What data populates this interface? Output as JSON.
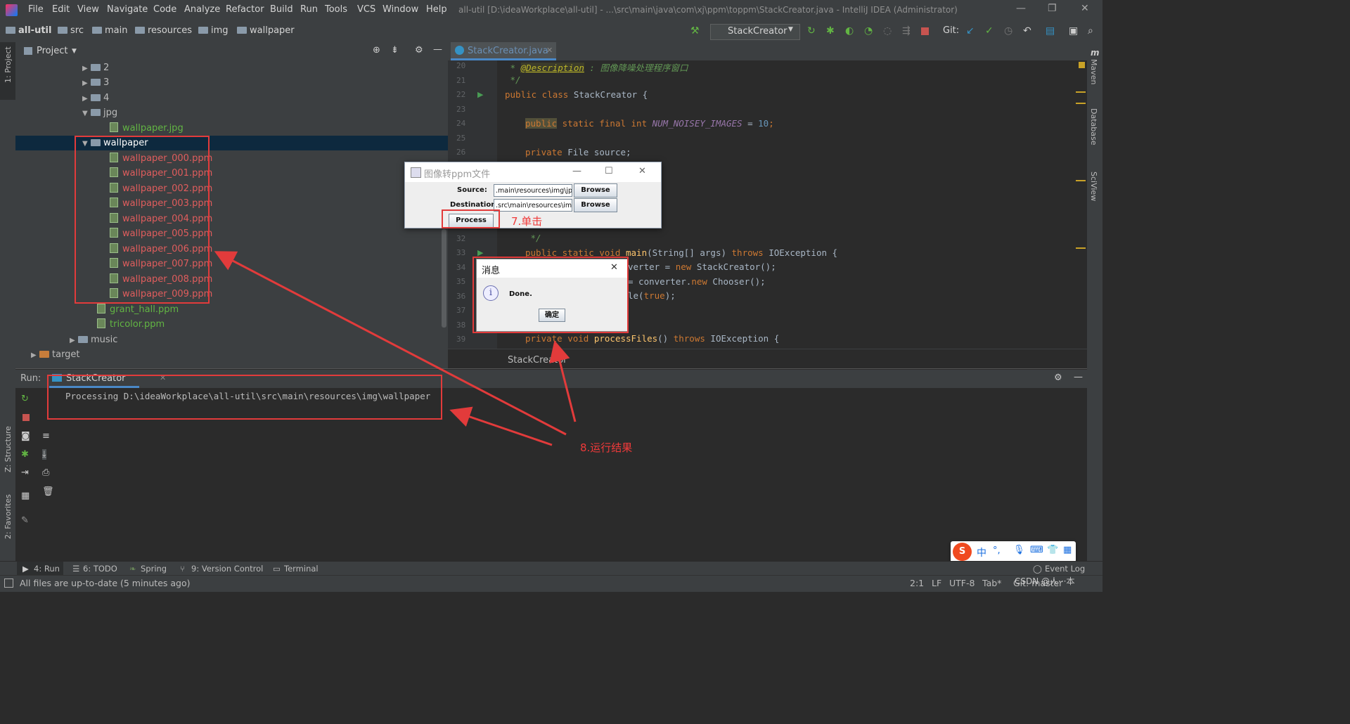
{
  "menubar": {
    "items": [
      "File",
      "Edit",
      "View",
      "Navigate",
      "Code",
      "Analyze",
      "Refactor",
      "Build",
      "Run",
      "Tools",
      "VCS",
      "Window",
      "Help"
    ],
    "window_title": "all-util [D:\\ideaWorkplace\\all-util] - ...\\src\\main\\java\\com\\xj\\ppm\\toppm\\StackCreator.java - IntelliJ IDEA (Administrator)"
  },
  "navbar": {
    "breadcrumbs": [
      "all-util",
      "src",
      "main",
      "resources",
      "img",
      "wallpaper"
    ],
    "run_config": "StackCreator",
    "git_label": "Git:"
  },
  "left_strip": {
    "project": "1: Project",
    "structure": "Z: Structure",
    "favorites": "2: Favorites"
  },
  "right_strip": {
    "maven": "Maven",
    "database": "Database",
    "sciview": "SciView"
  },
  "project_panel": {
    "title": "Project",
    "tree": [
      {
        "label": "2",
        "type": "folder",
        "expanded": false
      },
      {
        "label": "3",
        "type": "folder",
        "expanded": false
      },
      {
        "label": "4",
        "type": "folder",
        "expanded": false
      },
      {
        "label": "jpg",
        "type": "folder",
        "expanded": true
      },
      {
        "label": "wallpaper.jpg",
        "type": "file"
      },
      {
        "label": "wallpaper",
        "type": "folder",
        "expanded": true,
        "selected": true
      },
      {
        "label": "wallpaper_000.ppm",
        "type": "file"
      },
      {
        "label": "wallpaper_001.ppm",
        "type": "file"
      },
      {
        "label": "wallpaper_002.ppm",
        "type": "file"
      },
      {
        "label": "wallpaper_003.ppm",
        "type": "file"
      },
      {
        "label": "wallpaper_004.ppm",
        "type": "file"
      },
      {
        "label": "wallpaper_005.ppm",
        "type": "file"
      },
      {
        "label": "wallpaper_006.ppm",
        "type": "file"
      },
      {
        "label": "wallpaper_007.ppm",
        "type": "file"
      },
      {
        "label": "wallpaper_008.ppm",
        "type": "file"
      },
      {
        "label": "wallpaper_009.ppm",
        "type": "file"
      },
      {
        "label": "grant_hall.ppm",
        "type": "file"
      },
      {
        "label": "tricolor.ppm",
        "type": "file"
      },
      {
        "label": "music",
        "type": "folder",
        "expanded": false
      },
      {
        "label": "target",
        "type": "folder",
        "expanded": false
      }
    ]
  },
  "editor": {
    "tab_label": "StackCreator.java",
    "breadcrumb": "StackCreator",
    "line_numbers": [
      "20",
      "21",
      "22",
      "23",
      "24",
      "25",
      "26",
      "32",
      "33",
      "34",
      "35",
      "36",
      "37",
      "38",
      "39"
    ],
    "lines": {
      "l20_a": " * ",
      "l20_b": "@Description",
      "l20_c": " : 图像降噪处理程序窗口",
      "l21": " */",
      "l22_a": "public class ",
      "l22_b": "StackCreator {",
      "l24_a": "public",
      "l24_b": " static final int ",
      "l24_c": "NUM_NOISEY_IMAGES",
      "l24_d": " = ",
      "l24_e": "10",
      "l24_f": ";",
      "l26_a": "private ",
      "l26_b": "File source;",
      "l32": " */",
      "l33_a": "public static void ",
      "l33_b": "main",
      "l33_c": "(String[] args) ",
      "l33_d": "throws ",
      "l33_e": "IOException {",
      "l34_a": "verter = ",
      "l34_b": "new ",
      "l34_c": "StackCreator();",
      "l35_a": "= converter.",
      "l35_b": "new ",
      "l35_c": "Chooser();",
      "l36_a": "le(",
      "l36_b": "true",
      "l36_c": ");",
      "l39_a": "private void ",
      "l39_b": "processFiles",
      "l39_c": "() ",
      "l39_d": "throws ",
      "l39_e": "IOException {"
    }
  },
  "swing_dialog": {
    "title": "图像转ppm文件",
    "source_label": "Source:",
    "source_value": ".main\\resources\\img\\jpg",
    "destination_label": "Destination:",
    "destination_value": ".src\\main\\resources\\img",
    "browse_label": "Browse",
    "process_label": "Process"
  },
  "message_dialog": {
    "title": "消息",
    "message": "Done.",
    "ok_label": "确定"
  },
  "run_panel": {
    "label": "Run:",
    "tab": "StackCreator",
    "output": "Processing D:\\ideaWorkplace\\all-util\\src\\main\\resources\\img\\wallpaper"
  },
  "annotations": {
    "step7": "7.单击",
    "step8": "8.运行结果"
  },
  "bottom_tabs": [
    "4: Run",
    "6: TODO",
    "Spring",
    "9: Version Control",
    "Terminal"
  ],
  "event_log": "Event Log",
  "status": {
    "message": "All files are up-to-date (5 minutes ago)",
    "position": "2:1",
    "line_sep": "LF",
    "encoding": "UTF-8",
    "indent": "Tab*",
    "git": "Git: master"
  },
  "ime": {
    "lang": "中"
  },
  "watermark": "CSDN @人···本",
  "colors": {
    "annotation_red": "#e23b3b",
    "ppm_file_red": "#e05d5d",
    "selection": "#0d293e"
  }
}
